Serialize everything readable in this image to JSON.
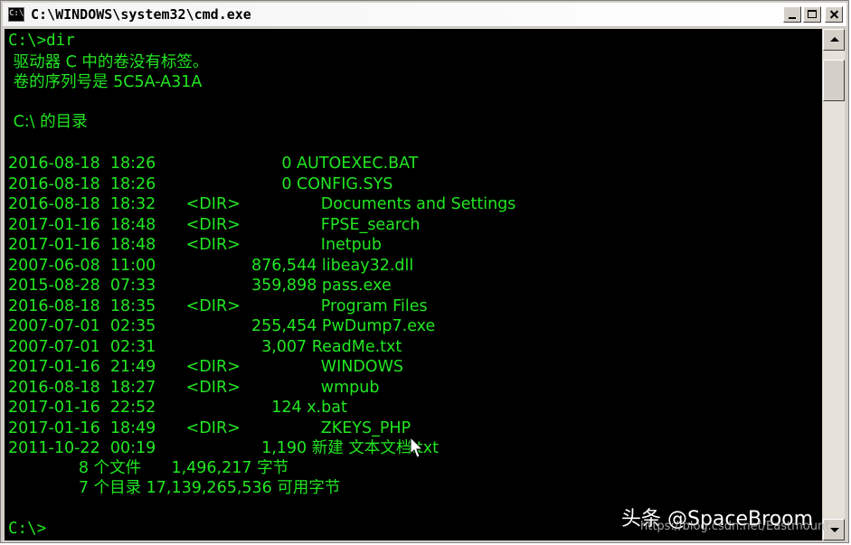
{
  "window": {
    "title": "C:\\WINDOWS\\system32\\cmd.exe",
    "icon": "cmd-icon",
    "controls": [
      "minimize",
      "maximize",
      "close"
    ]
  },
  "console": {
    "prompt_command": "C:\\>dir",
    "volume_line": " 驱动器 C 中的卷没有标签。",
    "serial_line": " 卷的序列号是 5C5A-A31A",
    "dir_of_line": " C:\\ 的目录",
    "entries": [
      {
        "date": "2016-08-18",
        "time": "18:26",
        "dir": "",
        "size": "0",
        "name": "AUTOEXEC.BAT"
      },
      {
        "date": "2016-08-18",
        "time": "18:26",
        "dir": "",
        "size": "0",
        "name": "CONFIG.SYS"
      },
      {
        "date": "2016-08-18",
        "time": "18:32",
        "dir": "<DIR>",
        "size": "",
        "name": "Documents and Settings"
      },
      {
        "date": "2017-01-16",
        "time": "18:48",
        "dir": "<DIR>",
        "size": "",
        "name": "FPSE_search"
      },
      {
        "date": "2017-01-16",
        "time": "18:48",
        "dir": "<DIR>",
        "size": "",
        "name": "Inetpub"
      },
      {
        "date": "2007-06-08",
        "time": "11:00",
        "dir": "",
        "size": "876,544",
        "name": "libeay32.dll"
      },
      {
        "date": "2015-08-28",
        "time": "07:33",
        "dir": "",
        "size": "359,898",
        "name": "pass.exe"
      },
      {
        "date": "2016-08-18",
        "time": "18:35",
        "dir": "<DIR>",
        "size": "",
        "name": "Program Files"
      },
      {
        "date": "2007-07-01",
        "time": "02:35",
        "dir": "",
        "size": "255,454",
        "name": "PwDump7.exe"
      },
      {
        "date": "2007-07-01",
        "time": "02:31",
        "dir": "",
        "size": "3,007",
        "name": "ReadMe.txt"
      },
      {
        "date": "2017-01-16",
        "time": "21:49",
        "dir": "<DIR>",
        "size": "",
        "name": "WINDOWS"
      },
      {
        "date": "2016-08-18",
        "time": "18:27",
        "dir": "<DIR>",
        "size": "",
        "name": "wmpub"
      },
      {
        "date": "2017-01-16",
        "time": "22:52",
        "dir": "",
        "size": "124",
        "name": "x.bat"
      },
      {
        "date": "2017-01-16",
        "time": "18:49",
        "dir": "<DIR>",
        "size": "",
        "name": "ZKEYS_PHP"
      },
      {
        "date": "2011-10-22",
        "time": "00:19",
        "dir": "",
        "size": "1,190",
        "name": "新建 文本文档.txt"
      }
    ],
    "summary_files": "              8 个文件      1,496,217 字节",
    "summary_dirs": "              7 个目录 17,139,265,536 可用字节",
    "final_prompt": "C:\\>"
  },
  "watermark": {
    "main": "头条 @SpaceBroom",
    "url": "https://blog.csdn.net/Eastmount"
  },
  "colors": {
    "console_bg": "#000000",
    "console_fg": "#22e622"
  }
}
